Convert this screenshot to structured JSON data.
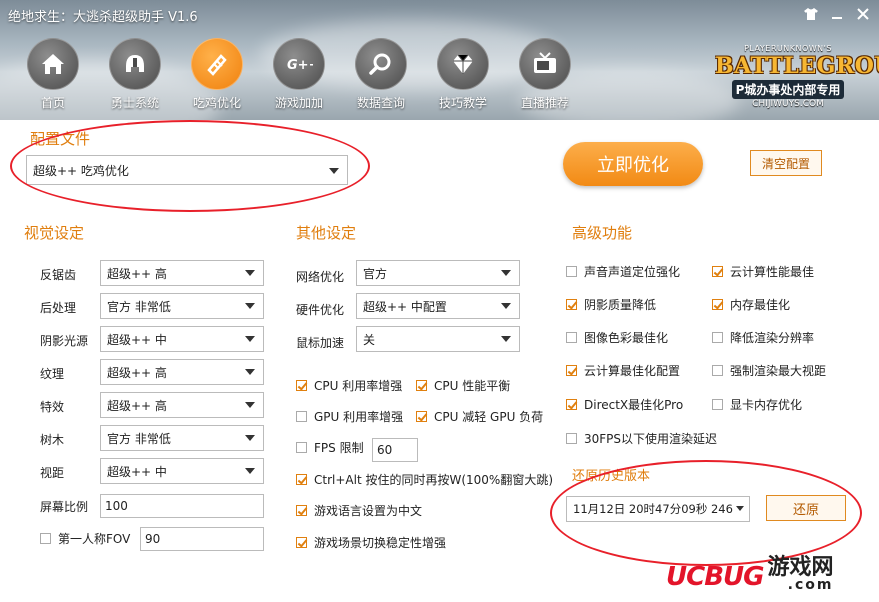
{
  "window": {
    "title": "绝地求生：大逃杀超级助手 V1.6",
    "controls": [
      "shirt-icon",
      "minimize",
      "close"
    ]
  },
  "nav": [
    {
      "label": "首页",
      "icon": "home-icon",
      "active": false
    },
    {
      "label": "勇士系统",
      "icon": "helmet-icon",
      "active": false
    },
    {
      "label": "吃鸡优化",
      "icon": "optimize-icon",
      "active": true
    },
    {
      "label": "游戏加加",
      "icon": "gplus-icon",
      "active": false
    },
    {
      "label": "数据查询",
      "icon": "search-icon",
      "active": false
    },
    {
      "label": "技巧教学",
      "icon": "diamond-icon",
      "active": false
    },
    {
      "label": "直播推荐",
      "icon": "tv-icon",
      "active": false
    }
  ],
  "brand": {
    "small": "PLAYERUNKNOWN'S",
    "big": "BATTLEGROUNDS",
    "sub": "P城办事处内部专用",
    "url": "CHIJIWUYS.COM"
  },
  "config": {
    "title": "配置文件",
    "selected": "超级++ 吃鸡优化",
    "optimize_label": "立即优化",
    "clear_label": "清空配置"
  },
  "visual": {
    "title": "视觉设定",
    "rows": [
      {
        "label": "反锯齿",
        "value": "超级++ 高"
      },
      {
        "label": "后处理",
        "value": "官方 非常低"
      },
      {
        "label": "阴影光源",
        "value": "超级++ 中"
      },
      {
        "label": "纹理",
        "value": "超级++ 高"
      },
      {
        "label": "特效",
        "value": "超级++ 高"
      },
      {
        "label": "树木",
        "value": "官方 非常低"
      },
      {
        "label": "视距",
        "value": "超级++ 中"
      }
    ],
    "screen_ratio_label": "屏幕比例",
    "screen_ratio_value": "100",
    "fov_label": "第一人称FOV",
    "fov_value": "90"
  },
  "other": {
    "title": "其他设定",
    "rows": [
      {
        "label": "网络优化",
        "value": "官方"
      },
      {
        "label": "硬件优化",
        "value": "超级++ 中配置"
      },
      {
        "label": "鼠标加速",
        "value": "关"
      }
    ],
    "checks": [
      {
        "label": "CPU 利用率增强",
        "checked": true
      },
      {
        "label": "CPU 性能平衡",
        "checked": true
      },
      {
        "label": "GPU 利用率增强",
        "checked": false
      },
      {
        "label": "CPU 减轻 GPU 负荷",
        "checked": true
      }
    ],
    "fps_label": "FPS 限制",
    "fps_checked": false,
    "fps_value": "60",
    "checks2": [
      {
        "label": "Ctrl+Alt 按住的同时再按W(100%翻窗大跳)",
        "checked": true
      },
      {
        "label": "游戏语言设置为中文",
        "checked": true
      },
      {
        "label": "游戏场景切换稳定性增强",
        "checked": true
      }
    ]
  },
  "advanced": {
    "title": "高级功能",
    "left": [
      {
        "label": "声音声道定位强化",
        "checked": false
      },
      {
        "label": "阴影质量降低",
        "checked": true
      },
      {
        "label": "图像色彩最佳化",
        "checked": false
      },
      {
        "label": "云计算最佳化配置",
        "checked": true
      },
      {
        "label": "DirectX最佳化Pro",
        "checked": true
      },
      {
        "label": "30FPS以下使用渲染延迟",
        "checked": false
      }
    ],
    "right": [
      {
        "label": "云计算性能最佳",
        "checked": true
      },
      {
        "label": "内存最佳化",
        "checked": true
      },
      {
        "label": "降低渲染分辨率",
        "checked": false
      },
      {
        "label": "强制渲染最大视距",
        "checked": false
      },
      {
        "label": "显卡内存优化",
        "checked": false
      }
    ]
  },
  "restore": {
    "title": "还原历史版本",
    "selected": "11月12日 20时47分09秒 246",
    "button_label": "还原"
  },
  "watermark": {
    "logo": "UCBUG",
    "cn": "游戏网",
    "com": ".com"
  },
  "colors": {
    "accent": "#f28a14",
    "section_title": "#e07e0e",
    "annotation_red": "#e8202a"
  }
}
